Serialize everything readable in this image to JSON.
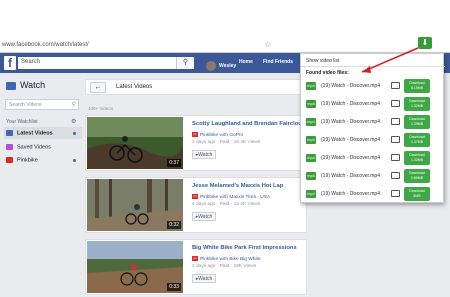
{
  "browser": {
    "url": "www.facebook.com/watch/latest/"
  },
  "fb_header": {
    "search_placeholder": "Search",
    "user_name": "Wesley",
    "nav_home": "Home",
    "nav_find_friends": "Find Friends"
  },
  "sidebar": {
    "title": "Watch",
    "search_placeholder": "Search Videos",
    "section_heading": "Your Watchlist",
    "items": [
      {
        "label": "Latest Videos"
      },
      {
        "label": "Saved Videos"
      },
      {
        "label": "Pinkbike"
      }
    ]
  },
  "main": {
    "section_title": "Latest Videos",
    "count_text": "100+ Videos",
    "videos": [
      {
        "title": "Scotty Laughland and Brendan Fairclough",
        "channel": "Pinkbike",
        "with_text": " with ",
        "partner": "GoPro",
        "stats": "2 days ago · Paid · 18.4K Views",
        "duration": "0:37",
        "watch_label": "Watch"
      },
      {
        "title": "Jesse Melamed's Maxxis Hot Lap",
        "channel": "Pinkbike",
        "with_text": " with ",
        "partner": "Maxxis Tires - USA",
        "stats": "4 days ago · Paid · 13.2K Views",
        "duration": "0:32",
        "watch_label": "Watch"
      },
      {
        "title": "Big White Bike Park First Impressions",
        "channel": "Pinkbike",
        "with_text": " with ",
        "partner": "Bike Big White",
        "stats": "2 days ago · Paid · 19K Views",
        "duration": "0:33",
        "watch_label": "Watch"
      }
    ]
  },
  "popup": {
    "show_list": "Show video list",
    "found_label": "Found video files:",
    "files": [
      {
        "format": "mp4",
        "name": "(19) Watch - Discover.mp4",
        "download": "Download",
        "size": "8.15MB"
      },
      {
        "format": "mp4",
        "name": "(19) Watch - Discover.mp4",
        "download": "Download",
        "size": "1.32MB"
      },
      {
        "format": "mp4",
        "name": "(19) Watch - Discover.mp4",
        "download": "Download",
        "size": "1.39MB"
      },
      {
        "format": "mp4",
        "name": "(19) Watch - Discover.mp4",
        "download": "Download",
        "size": "1.37MB"
      },
      {
        "format": "mp4",
        "name": "(19) Watch - Discover.mp4",
        "download": "Download",
        "size": "1.32MB"
      },
      {
        "format": "mp4",
        "name": "(19) Watch - Discover.mp4",
        "download": "Download",
        "size": "0.86MB"
      },
      {
        "format": "mp4",
        "name": "(19) Watch - Discover.mp4",
        "download": "Download",
        "size": "8MB"
      }
    ]
  },
  "colors": {
    "fb_blue": "#3b5998",
    "download_green": "#3ea846",
    "annotation_red": "#d62020"
  },
  "icons": {
    "extension": "download-arrow-icon",
    "cast": "cast-icon",
    "back": "back-arrow-icon",
    "search": "magnifier-icon"
  }
}
